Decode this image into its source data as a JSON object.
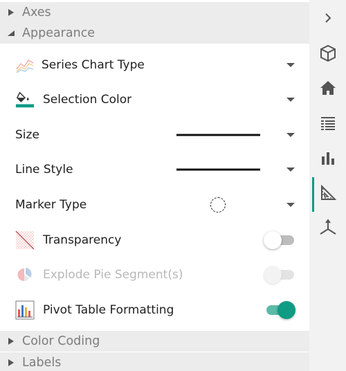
{
  "sections": {
    "axes": {
      "label": "Axes",
      "expanded": false
    },
    "appearance": {
      "label": "Appearance",
      "expanded": true
    },
    "color_coding": {
      "label": "Color Coding",
      "expanded": false
    },
    "labels": {
      "label": "Labels",
      "expanded": false
    }
  },
  "appearance": {
    "series_chart_type": {
      "label": "Series Chart Type",
      "icon": "line-chart-icon"
    },
    "selection_color": {
      "label": "Selection Color",
      "icon": "paint-bucket-icon",
      "color": "#0f9b84"
    },
    "size": {
      "label": "Size"
    },
    "line_style": {
      "label": "Line Style"
    },
    "marker_type": {
      "label": "Marker Type"
    },
    "transparency": {
      "label": "Transparency",
      "icon": "transparency-icon",
      "enabled": false
    },
    "explode_pie": {
      "label": "Explode Pie Segment(s)",
      "icon": "pie-icon",
      "enabled": false,
      "disabled": true
    },
    "pivot_table_formatting": {
      "label": "Pivot Table Formatting",
      "icon": "pivot-table-icon",
      "enabled": true
    }
  },
  "rail": {
    "items": [
      "chevron-right-icon",
      "cube-icon",
      "home-icon",
      "list-icon",
      "bar-chart-icon",
      "ruler-triangle-icon",
      "axes-3d-icon"
    ],
    "active": "ruler-triangle-icon"
  },
  "colors": {
    "accent": "#0f9b84",
    "accent_light": "#5cbaa8"
  }
}
